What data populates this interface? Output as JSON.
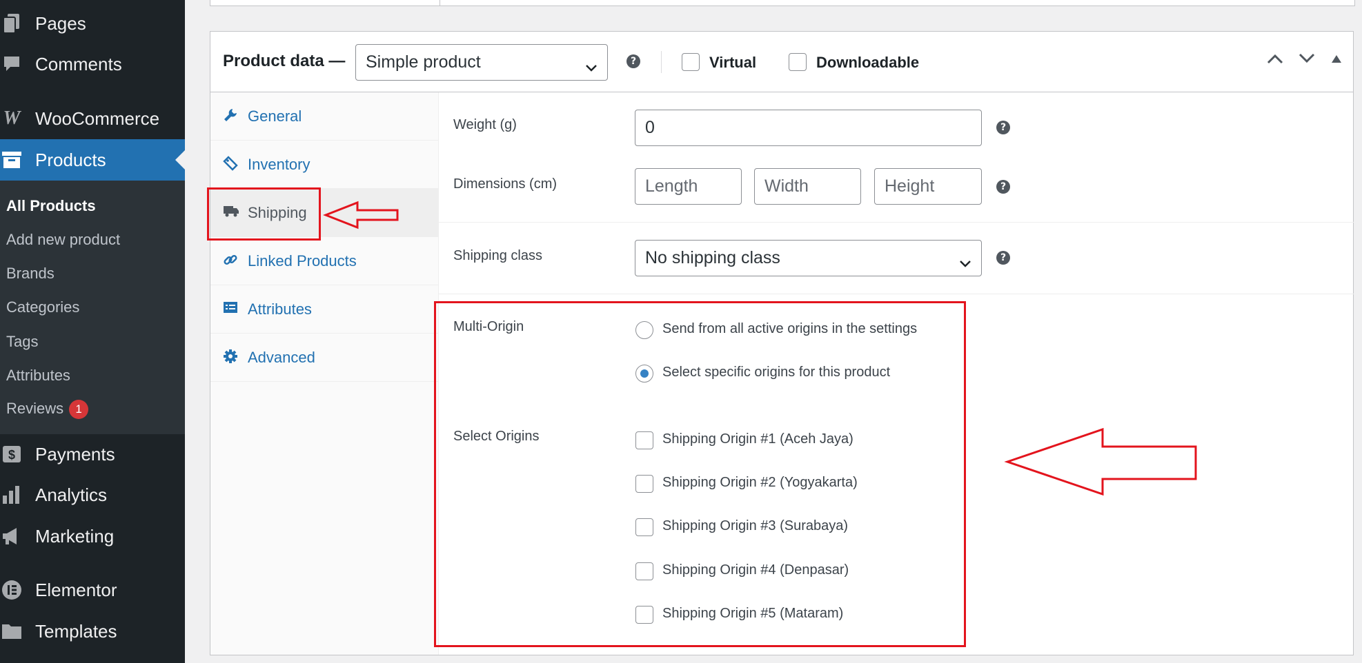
{
  "sidebar": {
    "menu": [
      {
        "label": "Pages",
        "icon": "pages-icon"
      },
      {
        "label": "Comments",
        "icon": "comments-icon"
      },
      {
        "label": "WooCommerce",
        "icon": "woocommerce-icon"
      },
      {
        "label": "Products",
        "icon": "products-icon"
      },
      {
        "label": "Payments",
        "icon": "payments-icon"
      },
      {
        "label": "Analytics",
        "icon": "analytics-icon"
      },
      {
        "label": "Marketing",
        "icon": "marketing-icon"
      },
      {
        "label": "Elementor",
        "icon": "elementor-icon"
      },
      {
        "label": "Templates",
        "icon": "templates-icon"
      }
    ],
    "active": "Products",
    "submenu": [
      "All Products",
      "Add new product",
      "Brands",
      "Categories",
      "Tags",
      "Attributes",
      "Reviews"
    ],
    "submenu_current": "All Products",
    "reviews_badge": "1"
  },
  "product_data": {
    "title": "Product data —",
    "type_select": "Simple product",
    "help": "?",
    "virtual_label": "Virtual",
    "downloadable_label": "Downloadable",
    "tabs": [
      {
        "label": "General",
        "icon": "wrench-icon"
      },
      {
        "label": "Inventory",
        "icon": "tag-icon"
      },
      {
        "label": "Shipping",
        "icon": "truck-icon"
      },
      {
        "label": "Linked Products",
        "icon": "link-icon"
      },
      {
        "label": "Attributes",
        "icon": "list-icon"
      },
      {
        "label": "Advanced",
        "icon": "gear-icon"
      }
    ],
    "active_tab": "Shipping"
  },
  "shipping": {
    "weight_label": "Weight (g)",
    "weight_value": "0",
    "dimensions_label": "Dimensions (cm)",
    "length_placeholder": "Length",
    "width_placeholder": "Width",
    "height_placeholder": "Height",
    "class_label": "Shipping class",
    "class_value": "No shipping class",
    "multi_origin_label": "Multi-Origin",
    "multi_origin_options": [
      "Send from all active origins in the settings",
      "Select specific origins for this product"
    ],
    "multi_origin_selected": "Select specific origins for this product",
    "select_origins_label": "Select Origins",
    "origins": [
      "Shipping Origin #1 (Aceh Jaya)",
      "Shipping Origin #2 (Yogyakarta)",
      "Shipping Origin #3 (Surabaya)",
      "Shipping Origin #4 (Denpasar)",
      "Shipping Origin #5 (Mataram)"
    ]
  },
  "colors": {
    "admin_sidebar": "#1d2327",
    "admin_submenu": "#2c3338",
    "accent": "#2271b1",
    "annotation": "#e3141d",
    "badge": "#d63638"
  }
}
